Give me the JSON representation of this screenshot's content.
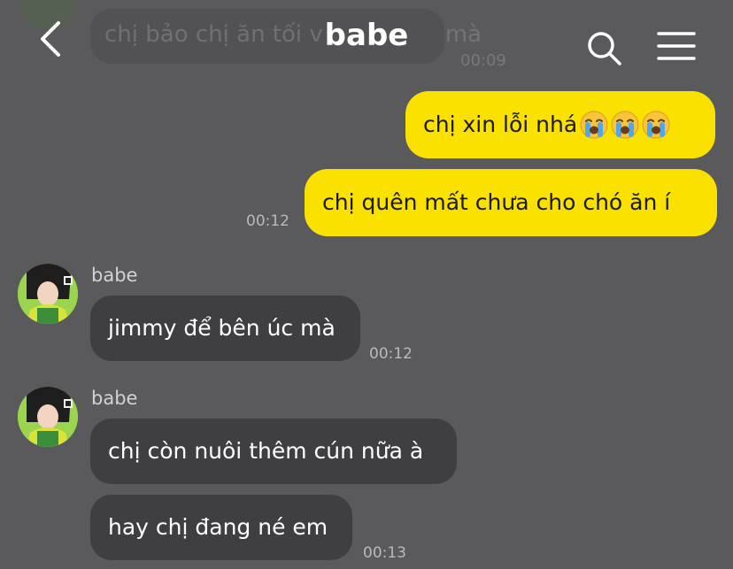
{
  "header": {
    "title": "babe",
    "back_icon": "chevron-left-icon",
    "search_icon": "search-icon",
    "menu_icon": "menu-icon"
  },
  "previous_message": {
    "text": "chị bảo chị ăn tối v",
    "text_tail": "mà",
    "time": "00:09"
  },
  "messages": [
    {
      "direction": "outgoing",
      "text": "chị xin lỗi nhá",
      "emoji": [
        "loudly-crying-face",
        "loudly-crying-face",
        "loudly-crying-face"
      ]
    },
    {
      "direction": "outgoing",
      "text": "chị quên mất chưa cho chó ăn í",
      "time": "00:12"
    },
    {
      "direction": "incoming",
      "sender": "babe",
      "text": "jimmy để bên úc mà",
      "time": "00:12"
    },
    {
      "direction": "incoming",
      "sender": "babe",
      "text": "chị còn nuôi thêm cún nữa à"
    },
    {
      "direction": "incoming",
      "text": "hay chị đang né em",
      "time": "00:13"
    }
  ],
  "colors": {
    "background": "#5a595c",
    "outgoing_bubble": "#fae100",
    "incoming_bubble": "#3f3e41"
  }
}
